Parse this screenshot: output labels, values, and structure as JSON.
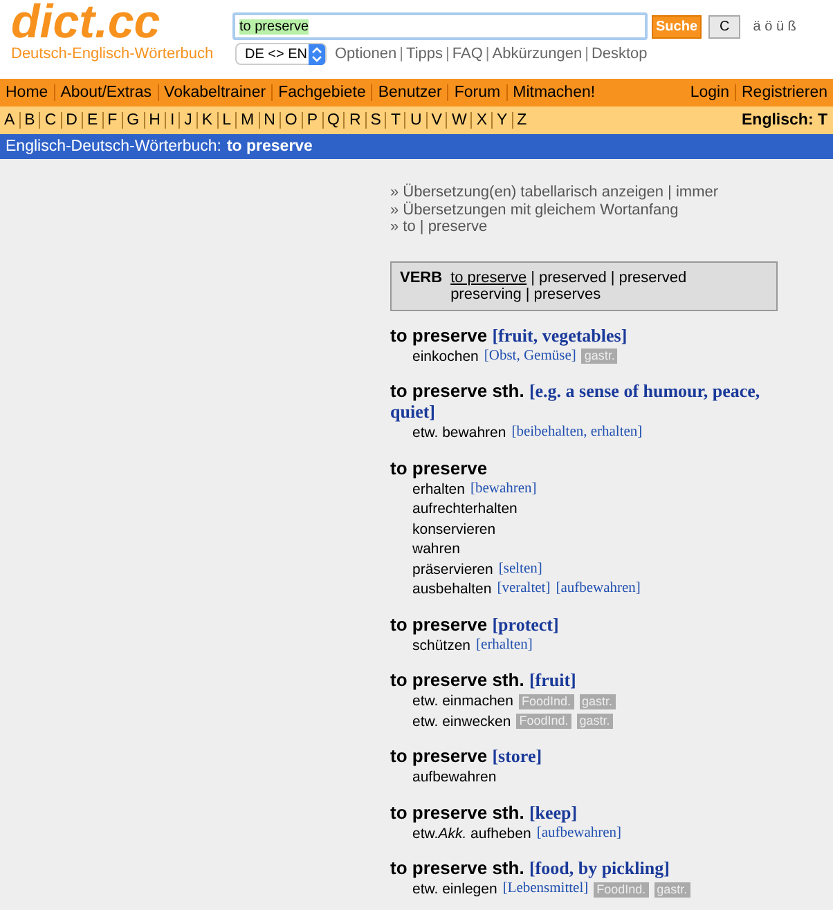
{
  "logo": {
    "title": "dict.cc",
    "subtitle": "Deutsch-Englisch-Wörterbuch"
  },
  "search": {
    "value": "to preserve",
    "button": "Suche",
    "clear": "C",
    "special_chars": [
      "ä",
      "ö",
      "ü",
      "ß"
    ],
    "direction": "DE <> EN",
    "separator": "|",
    "links": [
      "Optionen",
      "Tipps",
      "FAQ",
      "Abkürzungen",
      "Desktop"
    ]
  },
  "nav": {
    "left": [
      "Home",
      "About/Extras",
      "Vokabeltrainer",
      "Fachgebiete",
      "Benutzer",
      "Forum",
      "Mitmachen!"
    ],
    "right": [
      "Login",
      "Registrieren"
    ]
  },
  "alphabet": {
    "letters": [
      "A",
      "B",
      "C",
      "D",
      "E",
      "F",
      "G",
      "H",
      "I",
      "J",
      "K",
      "L",
      "M",
      "N",
      "O",
      "P",
      "Q",
      "R",
      "S",
      "T",
      "U",
      "V",
      "W",
      "X",
      "Y",
      "Z"
    ],
    "label": "Englisch: T"
  },
  "title_bar": {
    "label": "Englisch-Deutsch-Wörterbuch:",
    "query": "to preserve"
  },
  "options": [
    "» Übersetzung(en) tabellarisch anzeigen | immer",
    "» Übersetzungen mit gleichem Wortanfang",
    "» to | preserve"
  ],
  "verb": {
    "label": "VERB",
    "separator": "|",
    "rows": [
      [
        "to preserve",
        "preserved",
        "preserved"
      ],
      [
        "preserving",
        "preserves"
      ]
    ]
  },
  "entries": [
    {
      "term": "to preserve",
      "note": "[fruit, vegetables]",
      "translations": [
        {
          "text": "einkochen",
          "notes": [
            "[Obst, Gemüse]"
          ],
          "tags": [
            "gastr."
          ]
        }
      ]
    },
    {
      "term": "to preserve sth.",
      "note": "[e.g. a sense of humour, peace, quiet]",
      "translations": [
        {
          "text": "etw. bewahren",
          "notes": [
            "[beibehalten, erhalten]"
          ]
        }
      ]
    },
    {
      "term": "to preserve",
      "translations": [
        {
          "text": "erhalten",
          "notes": [
            "[bewahren]"
          ]
        },
        {
          "text": "aufrechterhalten"
        },
        {
          "text": "konservieren"
        },
        {
          "text": "wahren"
        },
        {
          "text": "präservieren",
          "notes": [
            "[selten]"
          ]
        },
        {
          "text": "ausbehalten",
          "notes": [
            "[veraltet]",
            "[aufbewahren]"
          ]
        }
      ]
    },
    {
      "term": "to preserve",
      "note": "[protect]",
      "translations": [
        {
          "text": "schützen",
          "notes": [
            "[erhalten]"
          ]
        }
      ]
    },
    {
      "term": "to preserve sth.",
      "note": "[fruit]",
      "translations": [
        {
          "text": "etw. einmachen",
          "tags": [
            "FoodInd.",
            "gastr."
          ]
        },
        {
          "text": "etw. einwecken",
          "tags": [
            "FoodInd.",
            "gastr."
          ]
        }
      ]
    },
    {
      "term": "to preserve",
      "note": "[store]",
      "translations": [
        {
          "text": "aufbewahren"
        }
      ]
    },
    {
      "term": "to preserve sth.",
      "note": "[keep]",
      "translations": [
        {
          "text": "etw.*Akk.* aufheben",
          "notes": [
            "[aufbewahren]"
          ]
        }
      ]
    },
    {
      "term": "to preserve sth.",
      "note": "[food, by pickling]",
      "translations": [
        {
          "text": "etw. einlegen",
          "notes": [
            "[Lebensmittel]"
          ],
          "tags": [
            "FoodInd.",
            "gastr."
          ]
        }
      ]
    }
  ]
}
